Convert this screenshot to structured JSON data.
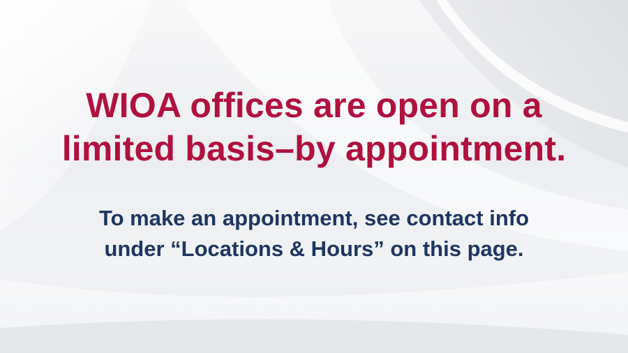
{
  "colors": {
    "headline": "#b0113e",
    "subline": "#1d3660",
    "background": "#eceef1"
  },
  "headline": {
    "line1": "WIOA offices are open on a",
    "line2": "limited basis–by appointment."
  },
  "subline": {
    "line1": "To make an appointment, see contact info",
    "line2": "under “Locations & Hours” on this page."
  }
}
